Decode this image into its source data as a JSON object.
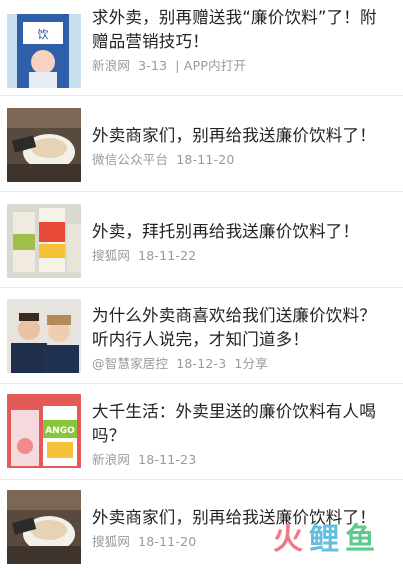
{
  "articles": [
    {
      "title": "求外卖，别再赠送我“廉价饮料”了！附赠品营销技巧！",
      "source": "新浪网",
      "date": "3-13",
      "extra": "| APP内打开",
      "thumb": "drink-bottle-icon"
    },
    {
      "title": "外卖商家们，别再给我送廉价饮料了！",
      "source": "微信公众平台",
      "date": "18-11-20",
      "extra": "",
      "thumb": "coffee-cup-icon"
    },
    {
      "title": "外卖，拜托别再给我送廉价饮料了！",
      "source": "搜狐网",
      "date": "18-11-22",
      "extra": "",
      "thumb": "juice-box-icon"
    },
    {
      "title": "为什么外卖商喜欢给我们送廉价饮料？听内行人说完，才知门道多！",
      "source": "@智慧家居控",
      "date": "18-12-3",
      "extra": "1分享",
      "thumb": "people-photo-icon"
    },
    {
      "title": "大千生活：外卖里送的廉价饮料有人喝吗？",
      "source": "新浪网",
      "date": "18-11-23",
      "extra": "",
      "thumb": "mango-juice-icon"
    },
    {
      "title": "外卖商家们，别再给我送廉价饮料了！",
      "source": "搜狐网",
      "date": "18-11-20",
      "extra": "",
      "thumb": "coffee-cup-icon"
    }
  ],
  "watermark": {
    "part1": "火",
    "part2": "鲤",
    "part3": "鱼"
  },
  "colors": {
    "title": "#222222",
    "meta": "#9a9a9a",
    "divider": "#ececec"
  }
}
